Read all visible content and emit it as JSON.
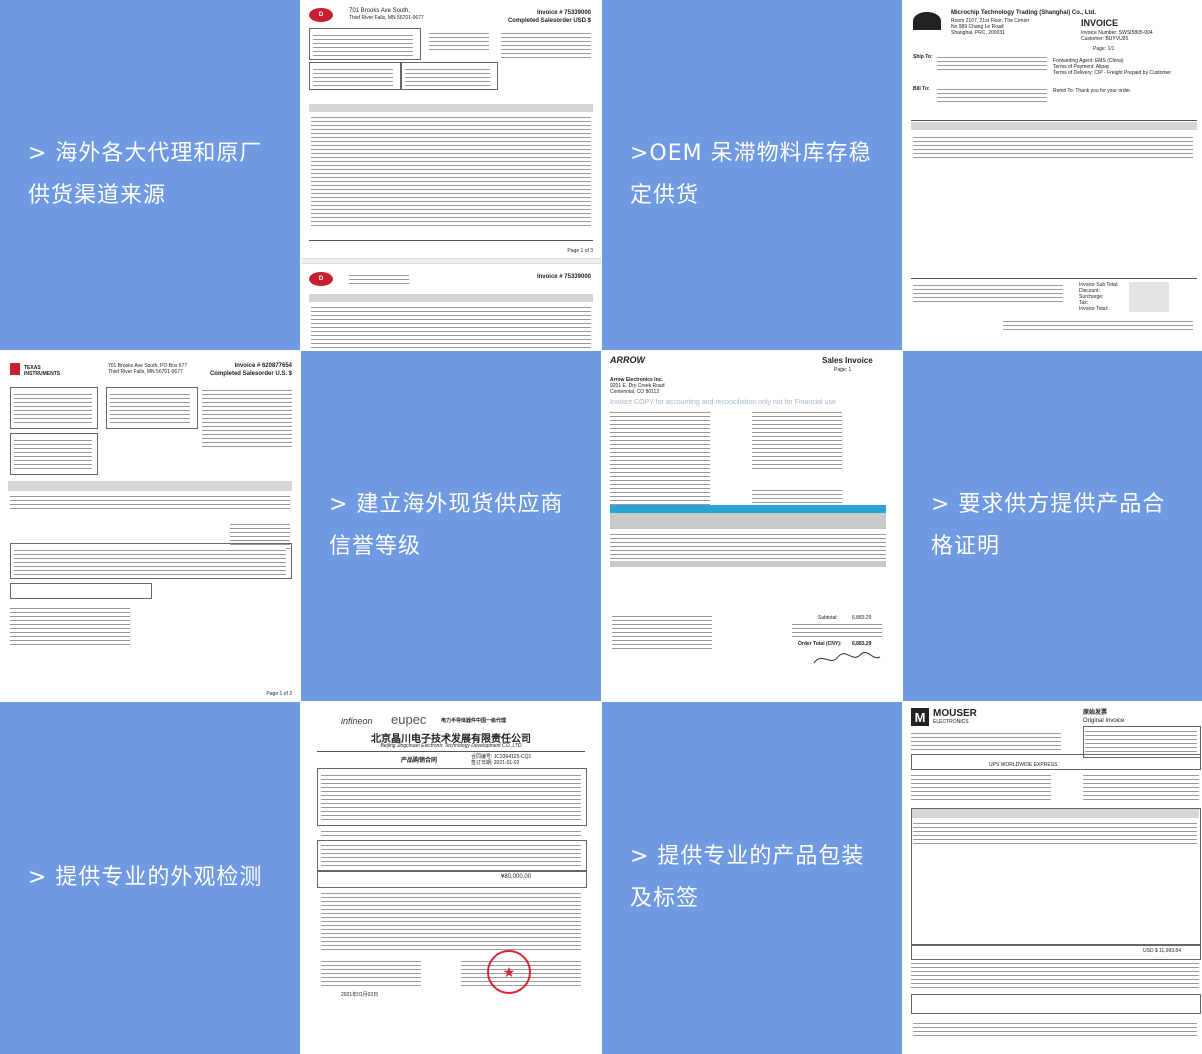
{
  "texts": {
    "r1c1": "> 海外各大代理和原厂供货渠道来源",
    "r1c3": ">OEM 呆滞物料库存稳定供货",
    "r2c2": "> 建立海外现货供应商信誉等级",
    "r2c4": "> 要求供方提供产品合格证明",
    "r3c1": "> 提供专业的外观检测",
    "r3c3": "> 提供专业的产品包装及标签"
  },
  "docs": {
    "digikey": {
      "company": "701 Brooks Ave South,",
      "city": "Thief River Falls, MN 56701-0677",
      "invoice": "Invoice # 75339000",
      "status": "Completed Salesorder USD $",
      "page": "Page 1 of 3"
    },
    "microchip": {
      "company": "Microchip Technology Trading (Shanghai) Co., Ltd.",
      "address1": "Room 2107, 21st Floor, The Center",
      "address2": "No 989 Chang Le Road",
      "address3": "Shanghai, PRC, 200031",
      "title": "INVOICE",
      "invoice_no": "Invoice Number: SWSI5805-004",
      "customer": "Customer: BUYVU95",
      "page": "Page: 1/1",
      "ship_to": "Ship To:",
      "bill_to": "Bill To:",
      "forwarding": "Forwarding Agent: EMS (China)",
      "payment": "Terms of Payment: Alipay",
      "delivery": "Terms of Delivery: CIP - Freight Prepaid by Customer",
      "remit": "Remit To: Thank you for your order.",
      "subtotal": "Invoice Sub Total:",
      "discount": "Discount:",
      "surcharge": "Surcharge:",
      "tax": "Tax:",
      "invoice_total": "Invoice Total:"
    },
    "ti": {
      "brand": "TEXAS INSTRUMENTS",
      "invoice": "Invoice # 620877654",
      "status": "Completed Salesorder U.S. $",
      "address": "701 Brooks Ave South, PO Box 677 Thief River Falls, MN 56701-0677",
      "page": "Page 1 of 2"
    },
    "arrow": {
      "brand": "ARROW",
      "title": "Sales Invoice",
      "page": "Page: 1",
      "company": "Arrow Electronics Inc.",
      "address": "9201 E. Dry Creek Road Centennial, CO 80112",
      "watermark": "Invoice COPY for accounting and reconciliation only not for Financial use",
      "subtotal": "Subtotal:",
      "subtotal_value": "6,883.29",
      "order_total": "Order Total (CNY):",
      "order_total_value": "6,883.29"
    },
    "infineon": {
      "brand1": "infineon",
      "brand2": "eupec",
      "slogan": "电力半导体器件中国一级代理",
      "company_cn": "北京晶川电子技术发展有限责任公司",
      "company_en": "Beijing Jingchuan Electronic Technology Development CO.,LTD",
      "title": "产品购销合同",
      "contract_no": "合同编号: JC3364125-CQ1",
      "date": "签订日期: 2021-01-02",
      "total": "¥80,000.00",
      "sign_date": "2021年01月02日"
    },
    "mouser": {
      "brand": "MOUSER",
      "brand_sub": "ELECTRONICS",
      "title_cn": "原始发票",
      "title_en": "Original Invoice",
      "shipper": "UPS WORLDWIDE EXPRESS",
      "total": "USD $ 11,993.84"
    }
  }
}
